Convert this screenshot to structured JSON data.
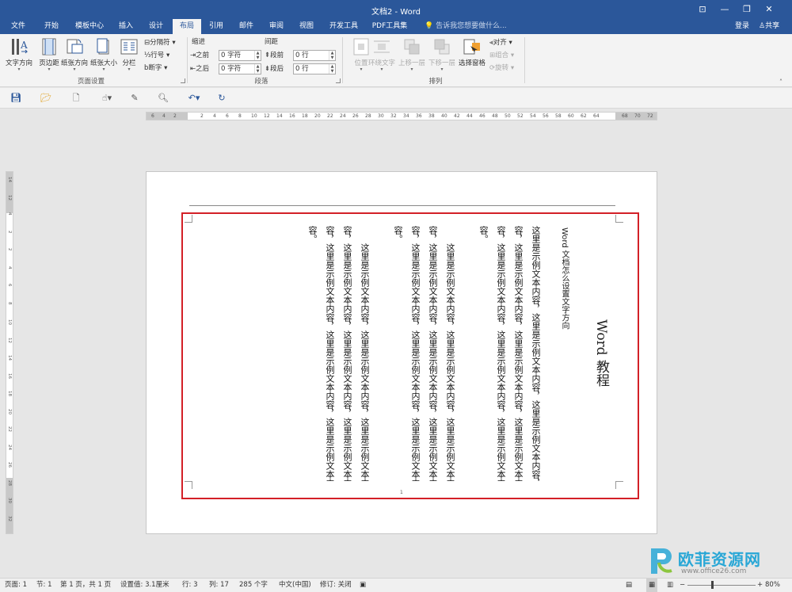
{
  "titlebar": {
    "title": "文档2 - Word"
  },
  "tabs": [
    {
      "label": "文件"
    },
    {
      "label": "开始"
    },
    {
      "label": "模板中心"
    },
    {
      "label": "插入"
    },
    {
      "label": "设计"
    },
    {
      "label": "布局"
    },
    {
      "label": "引用"
    },
    {
      "label": "邮件"
    },
    {
      "label": "审阅"
    },
    {
      "label": "视图"
    },
    {
      "label": "开发工具"
    },
    {
      "label": "PDF工具集"
    }
  ],
  "tell_me": {
    "placeholder": "告诉我您想要做什么..."
  },
  "account": {
    "login": "登录",
    "share": "共享"
  },
  "ribbon": {
    "page_setup": {
      "label": "页面设置",
      "text_direction": "文字方向",
      "margins": "页边距",
      "orientation": "纸张方向",
      "size": "纸张大小",
      "columns": "分栏",
      "breaks": "分隔符",
      "line_numbers": "行号",
      "hyphenation": "断字"
    },
    "paragraph": {
      "label": "段落",
      "indent": "缩进",
      "spacing": "间距",
      "indent_left": "之前",
      "indent_left_value": "0 字符",
      "indent_right": "之后",
      "indent_right_value": "0 字符",
      "space_before": "段前",
      "space_before_value": "0 行",
      "space_after": "段后",
      "space_after_value": "0 行"
    },
    "arrange": {
      "label": "排列",
      "position": "位置",
      "wrap_text": "环绕文字",
      "bring_forward": "上移一层",
      "send_backward": "下移一层",
      "selection_pane": "选择窗格",
      "align": "对齐",
      "group": "组合",
      "rotate": "旋转"
    }
  },
  "hruler_ticks": [
    "6",
    "4",
    "2",
    "2",
    "4",
    "6",
    "8",
    "10",
    "12",
    "14",
    "16",
    "18",
    "20",
    "22",
    "24",
    "26",
    "28",
    "30",
    "32",
    "34",
    "36",
    "38",
    "40",
    "42",
    "44",
    "46",
    "48",
    "50",
    "52",
    "54",
    "56",
    "58",
    "60",
    "62",
    "64",
    "68",
    "70",
    "72"
  ],
  "vruler_ticks": [
    "14",
    "12",
    "4",
    "2",
    "2",
    "4",
    "6",
    "8",
    "10",
    "12",
    "14",
    "16",
    "18",
    "20",
    "22",
    "24",
    "26",
    "28",
    "30",
    "32"
  ],
  "document": {
    "title": "Word 教程",
    "subtitle": "Word 文档怎么设置文字方向",
    "columns": [
      "这里是示例文本内容，这里是示例文本内容，这里是示例文本内容，这里是示例文本内",
      "容，这里是示例文本内容，这里是示例文本内容，这里是示例文本内容，这里是示例文本内",
      "容，这里是示例文本内容，这里是示例文本内容，这里是示例文本内容，这里是示例文本内",
      "容。",
      "这里是示例文本内容，这里是示例文本内容，这里是示例文本内容，这里是示例文本内",
      "容，这里是示例文本内容，这里是示例文本内容，这里是示例文本内容，这里是示例文本内",
      "容，这里是示例文本内容，这里是示例文本内容，这里是示例文本内容，这里是示例文本内",
      "容。",
      "这里是示例文本内容，这里是示例文本内容，这里是示例文本内容，这里是示例文本内",
      "容，这里是示例文本内容，这里是示例文本内容，这里是示例文本内容，这里是示例文本内",
      "容，这里是示例文本内容，这里是示例文本内容，这里是示例文本内容，这里是示例文本内",
      "容。"
    ],
    "page_number": "1"
  },
  "status": {
    "page": "页面: 1",
    "section": "节: 1",
    "page_of": "第 1 页，共 1 页",
    "setting": "设置值: 3.1厘米",
    "line": "行: 3",
    "column": "列: 17",
    "words": "285 个字",
    "language": "中文(中国)",
    "track": "修订: 关闭",
    "zoom": "80%"
  },
  "watermark": {
    "text": "欧菲资源网",
    "url": "www.office26.com"
  },
  "colors": {
    "brand": "#2b579a",
    "highlight": "#d32027",
    "watermark": "#29a7d6"
  }
}
